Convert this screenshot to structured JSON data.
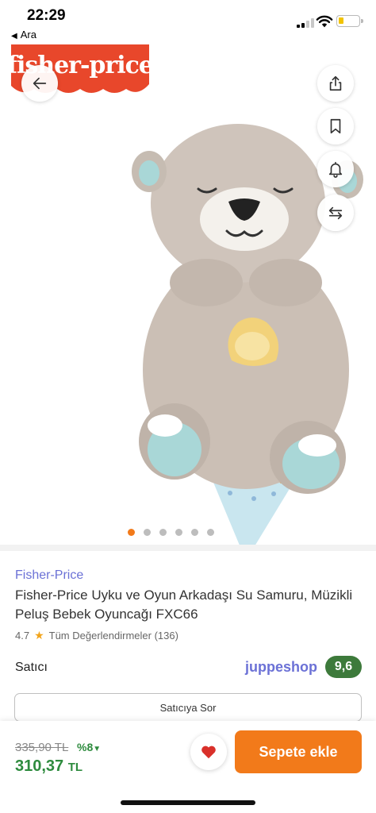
{
  "status": {
    "time": "22:29",
    "back_app": "Ara",
    "battery_color": "#f2c300"
  },
  "gallery": {
    "logo_text": "fisher-price",
    "logo_color": "#e8472b",
    "image_count": 6,
    "active_index": 0,
    "icons": [
      "arrow-left-icon",
      "share-icon",
      "bookmark-icon",
      "bell-icon",
      "compare-arrows-icon"
    ]
  },
  "product": {
    "brand": "Fisher-Price",
    "title": "Fisher-Price Uyku ve Oyun Arkadaşı Su Samuru, Müzikli Peluş Bebek Oyuncağı FXC66",
    "rating": "4.7",
    "reviews_label": "Tüm Değerlendirmeler (136)"
  },
  "seller": {
    "label": "Satıcı",
    "name": "juppeshop",
    "score": "9,6",
    "ask_label": "Satıcıya Sor"
  },
  "pricing": {
    "old_price": "335,90 TL",
    "discount": "%8",
    "new_price": "310,37",
    "currency": "TL",
    "add_to_cart": "Sepete ekle"
  },
  "colors": {
    "accent": "#f27a1a",
    "brand_link": "#6b71d6",
    "price_green": "#2e8b3e",
    "score_bg": "#3d7a3b"
  }
}
